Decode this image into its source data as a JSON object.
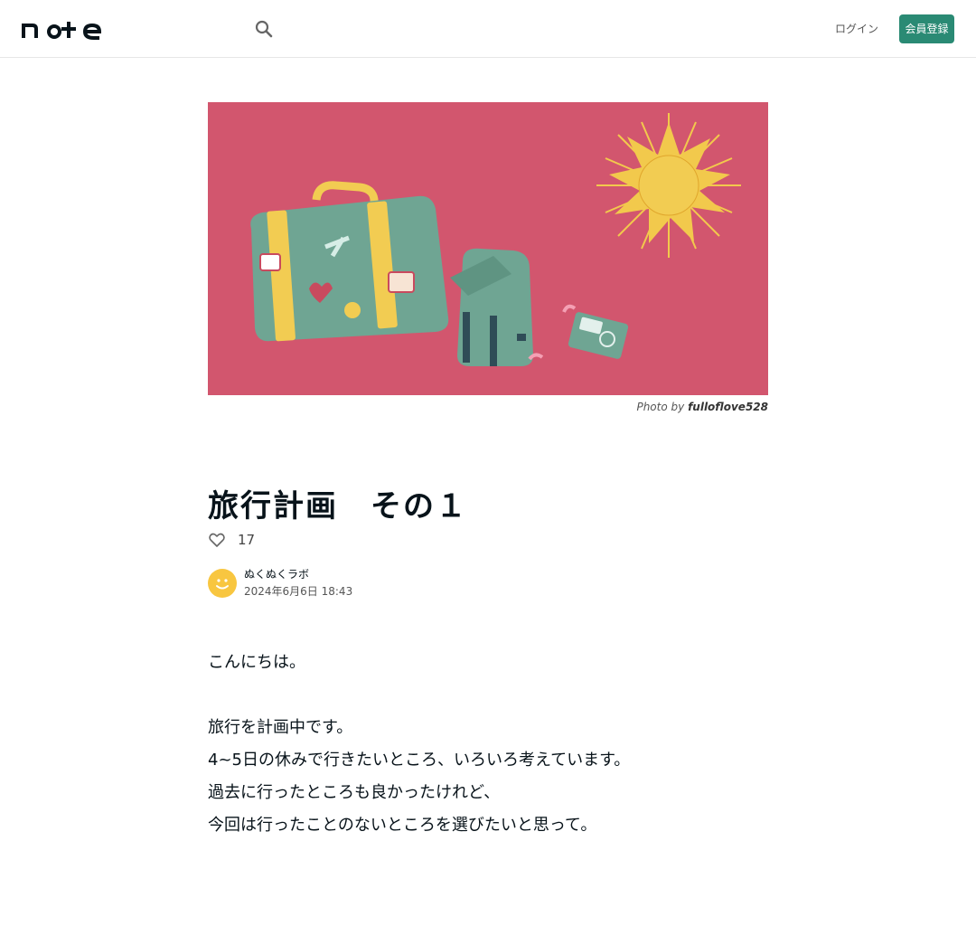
{
  "header": {
    "logo_text": "note",
    "login_label": "ログイン",
    "signup_label": "会員登録"
  },
  "hero": {
    "photo_credit_prefix": "Photo by",
    "photo_credit_author": "fulloflove528",
    "background_color": "#d2566e"
  },
  "article": {
    "title": "旅行計画　その１",
    "like_count": "17",
    "author_name": "ぬくぬくラボ",
    "date": "2024年6月6日 18:43",
    "paragraphs": [
      "こんにちは。",
      "",
      "旅行を計画中です。",
      "4~5日の休みで行きたいところ、いろいろ考えています。",
      "過去に行ったところも良かったけれど、",
      "今回は行ったことのないところを選びたいと思って。"
    ]
  },
  "colors": {
    "accent": "#2a8a74",
    "suitcase": "#6fa593",
    "strap": "#f2cc52",
    "sun": "#f2c94c"
  }
}
